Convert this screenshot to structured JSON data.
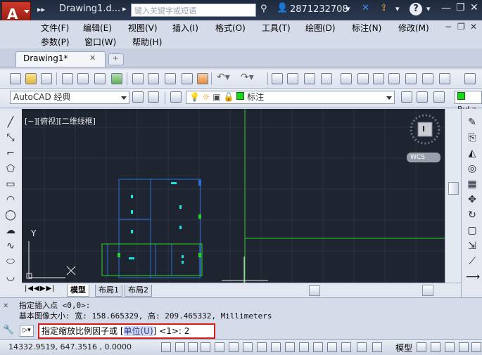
{
  "title_bar": {
    "title": "Drawing1.d...",
    "search_placeholder": "键入关键字或短语",
    "user": "2871232708",
    "help": "?"
  },
  "menu": {
    "row1": [
      "文件(F)",
      "编辑(E)",
      "视图(V)",
      "插入(I)",
      "格式(O)",
      "工具(T)",
      "绘图(D)",
      "标注(N)",
      "修改(M)"
    ],
    "row2": [
      "参数(P)",
      "窗口(W)",
      "帮助(H)"
    ]
  },
  "tabs": {
    "active": "Drawing1*"
  },
  "toolbar2": {
    "workspace": "AutoCAD 经典",
    "layer_name": "标注",
    "bylayer": "ByLa"
  },
  "viewport": {
    "label": "[−][俯视][二维线框]",
    "viewcube_face": "I",
    "wcs": "WCS",
    "axis_y": "Y",
    "axis_x": "X"
  },
  "layout_tabs": [
    "模型",
    "布局1",
    "布局2"
  ],
  "command": {
    "line1": "指定插入点 <0,0>:",
    "line2": "基本图像大小: 宽: 158.665329, 高: 209.465332, Millimeters",
    "prompt_prefix": "指定缩放比例因子或 [",
    "prompt_option": "单位(U)",
    "prompt_suffix": "] <1>:  2"
  },
  "status": {
    "coords": "14332.9519, 647.3516  , 0.0000",
    "model_label": "模型"
  },
  "colors": {
    "canvas_bg": "#1f2530",
    "blue_lines": "#2d6fd6",
    "green_lines": "#28d428",
    "cyan_marks": "#14e6e6",
    "highlight_border": "#d41c1c"
  }
}
